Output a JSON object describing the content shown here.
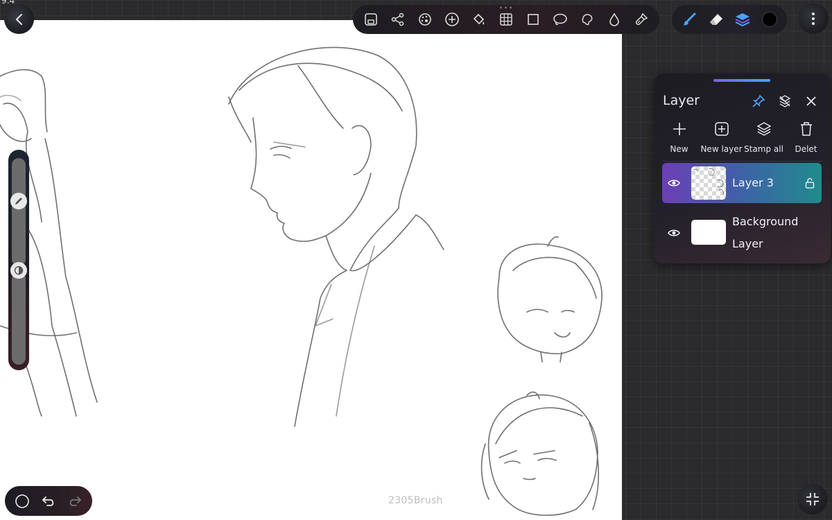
{
  "status_bar": {
    "time": "9:4"
  },
  "toolbar": {
    "icons": [
      "save-icon",
      "share-icon",
      "palette-icon",
      "add-icon",
      "fill-bucket-icon",
      "grid-icon",
      "rectangle-select-icon",
      "lasso-icon",
      "freeform-select-icon",
      "smudge-drop-icon",
      "clean-brush-icon"
    ]
  },
  "tools": {
    "icons": [
      "brush-icon",
      "eraser-icon",
      "layers-icon"
    ],
    "current_color": "#000000",
    "accent_color": "#4aa3ff"
  },
  "side_slider": {
    "size_level": 0.45,
    "opacity_level": 0.5
  },
  "bottom": {
    "brush_name": "2305Brush"
  },
  "layer_panel": {
    "title": "Layer",
    "actions": [
      {
        "label": "New",
        "icon": "plus-icon"
      },
      {
        "label": "New layer",
        "icon": "new-layer-icon"
      },
      {
        "label": "Stamp all",
        "icon": "stamp-all-icon"
      },
      {
        "label": "Delet",
        "icon": "trash-icon"
      }
    ],
    "layers": [
      {
        "name": "Layer 3",
        "active": true,
        "visible": true
      },
      {
        "name": "Background Layer",
        "active": false,
        "visible": true
      }
    ]
  }
}
